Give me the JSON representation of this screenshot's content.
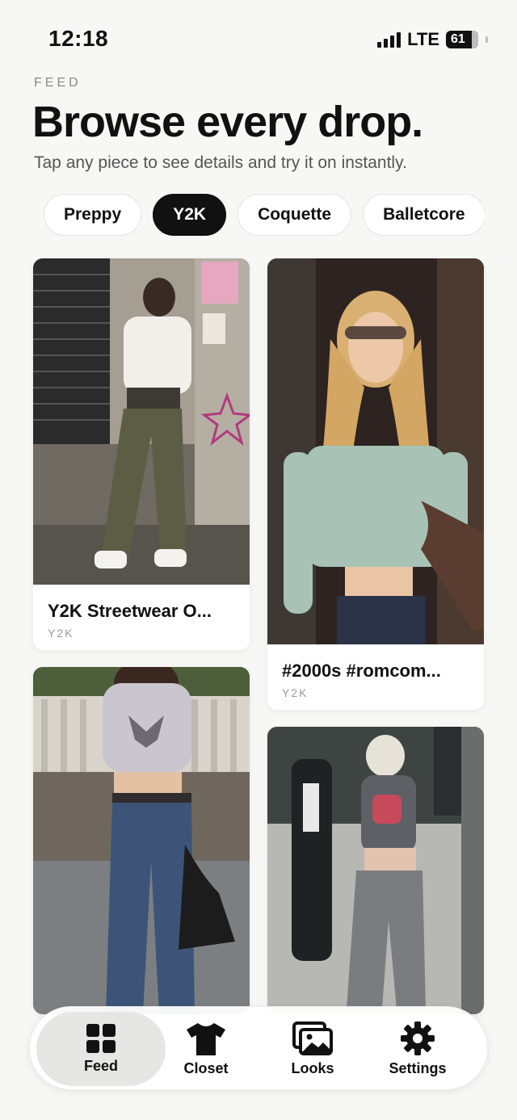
{
  "status_bar": {
    "time": "12:18",
    "network": "LTE",
    "battery": "61"
  },
  "header": {
    "eyebrow": "FEED",
    "title": "Browse every drop.",
    "subtitle": "Tap any piece to see details and try it on instantly."
  },
  "chips": [
    {
      "label": ""
    },
    {
      "label": "Preppy"
    },
    {
      "label": "Y2K",
      "active": true
    },
    {
      "label": "Coquette"
    },
    {
      "label": "Balletcore"
    }
  ],
  "feed": {
    "cards": [
      {
        "title": "Y2K Streetwear O...",
        "tag": "Y2K"
      },
      {
        "title": "#2000s #romcom...",
        "tag": "Y2K"
      },
      {
        "title": "",
        "tag": ""
      },
      {
        "title": "",
        "tag": ""
      }
    ]
  },
  "tabbar": {
    "items": [
      {
        "label": "Feed",
        "icon": "grid-icon",
        "active": true
      },
      {
        "label": "Closet",
        "icon": "tshirt-icon"
      },
      {
        "label": "Looks",
        "icon": "photos-icon"
      },
      {
        "label": "Settings",
        "icon": "gear-icon"
      }
    ]
  },
  "colors": {
    "background": "#f7f7f6",
    "chip_active": "#111111",
    "tab_active": "#e6e6e4"
  }
}
